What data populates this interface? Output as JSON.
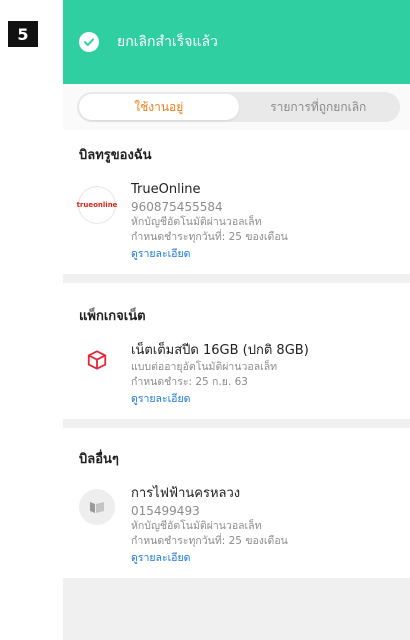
{
  "step": "5",
  "toast": {
    "message": "ยกเลิกสำเร็จแล้ว"
  },
  "tabs": [
    {
      "label": "ใช้งานอยู่",
      "active": true
    },
    {
      "label": "รายการที่ถูกยกเลิก",
      "active": false
    }
  ],
  "sections": {
    "my_bills": {
      "title": "บิลทรูของฉัน",
      "item": {
        "logo_text": "trueonline",
        "name": "TrueOnline",
        "number": "960875455584",
        "line1": "หักบัญชีอัตโนมัติผ่านวอลเล็ท",
        "line2": "กำหนดชำระทุกวันที่: 25 ของเดือน",
        "link": "ดูรายละเอียด"
      }
    },
    "net_package": {
      "title": "แพ็กเกจเน็ต",
      "item": {
        "name": "เน็ตเต็มสปีด 16GB (ปกติ 8GB)",
        "line1": "แบบต่ออายุอัตโนมัติผ่านวอลเล็ท",
        "line2": "กำหนดชำระ: 25 ก.ย. 63",
        "link": "ดูรายละเอียด"
      }
    },
    "other_bills": {
      "title": "บิลอื่นๆ",
      "item": {
        "name": "การไฟฟ้านครหลวง",
        "number": "015499493",
        "line1": "หักบัญชีอัตโนมัติผ่านวอลเล็ท",
        "line2": "กำหนดชำระทุกวันที่: 25 ของเดือน",
        "link": "ดูรายละเอียด"
      }
    }
  },
  "colors": {
    "toast_bg": "#2fcfa1",
    "active_tab": "#f07d18",
    "link": "#1b7ad6",
    "package_icon": "#e02a3a"
  }
}
